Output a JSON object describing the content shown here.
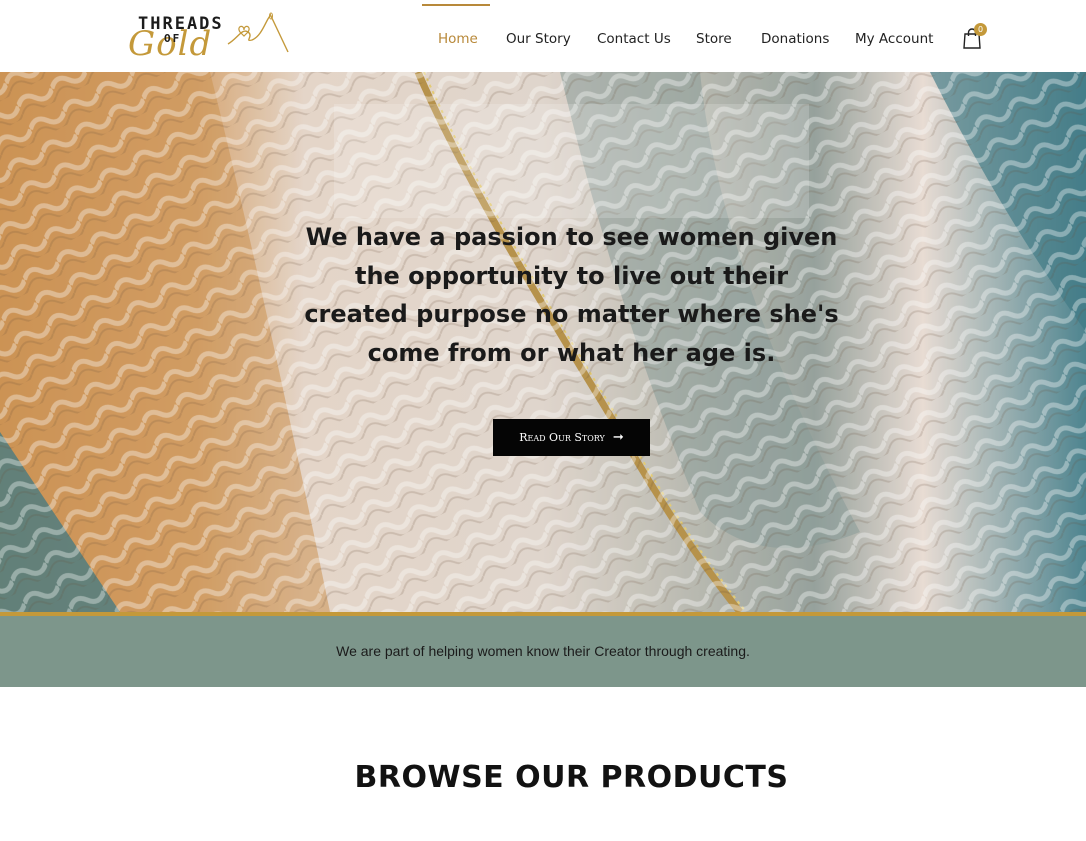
{
  "header": {
    "logo": {
      "line1": "THREADS",
      "line2": "OF",
      "script": "Gold"
    },
    "nav": [
      {
        "label": "Home",
        "active": true
      },
      {
        "label": "Our Story",
        "active": false
      },
      {
        "label": "Contact Us",
        "active": false
      },
      {
        "label": "Store",
        "active": false
      },
      {
        "label": "Donations",
        "active": false
      },
      {
        "label": "My Account",
        "active": false
      }
    ],
    "cart": {
      "icon": "shopping-bag-icon",
      "count": "0"
    }
  },
  "hero": {
    "text": "We have a passion to see women given the opportunity to live out their created purpose no matter where she's come from or what her age is.",
    "button_label": "Read Our Story",
    "button_icon": "arrow-right-icon"
  },
  "band": {
    "text": "We are part of helping women know their Creator through creating."
  },
  "products": {
    "title": "BROWSE OUR PRODUCTS"
  },
  "colors": {
    "accent_gold": "#c4993a",
    "band_green": "#7d968b",
    "button_black": "#050505"
  }
}
